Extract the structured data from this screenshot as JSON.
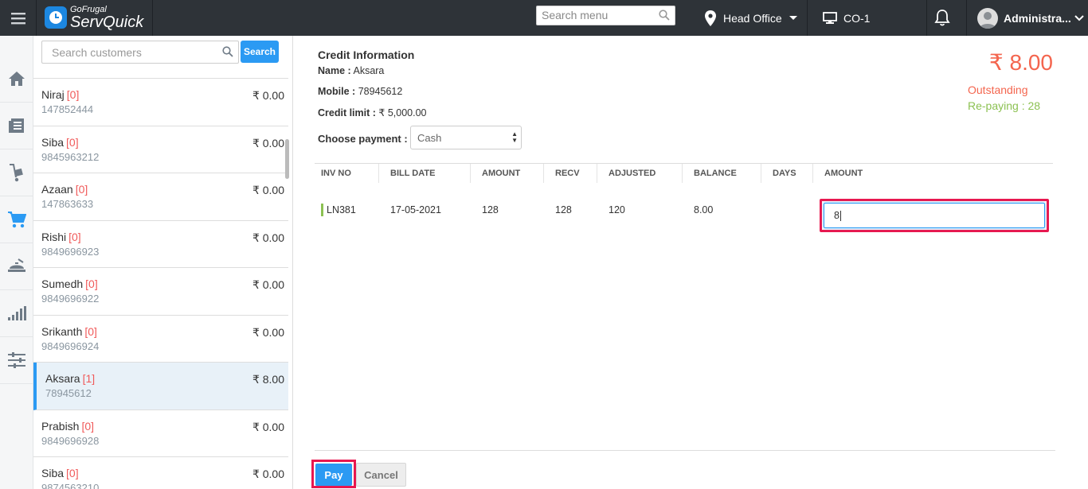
{
  "topbar": {
    "logo_small": "GoFrugal",
    "logo_big": "ServQuick",
    "search_placeholder": "Search menu",
    "location": "Head Office",
    "counter": "CO-1",
    "user": "Administra..."
  },
  "rail": {
    "icons": [
      "home-icon",
      "catalog-icon",
      "delivery-icon",
      "cart-icon",
      "kitchen-icon",
      "reports-icon",
      "settings-icon"
    ]
  },
  "customers": {
    "search_placeholder": "Search customers",
    "search_button": "Search",
    "items": [
      {
        "name": "Niraj",
        "count": "[0]",
        "phone": "147852444",
        "amount": "₹ 0.00"
      },
      {
        "name": "Siba",
        "count": "[0]",
        "phone": "9845963212",
        "amount": "₹ 0.00"
      },
      {
        "name": "Azaan",
        "count": "[0]",
        "phone": "147863633",
        "amount": "₹ 0.00"
      },
      {
        "name": "Rishi",
        "count": "[0]",
        "phone": "9849696923",
        "amount": "₹ 0.00"
      },
      {
        "name": "Sumedh",
        "count": "[0]",
        "phone": "9849696922",
        "amount": "₹ 0.00"
      },
      {
        "name": "Srikanth",
        "count": "[0]",
        "phone": "9849696924",
        "amount": "₹ 0.00"
      },
      {
        "name": "Aksara",
        "count": "[1]",
        "phone": "78945612",
        "amount": "₹ 8.00",
        "active": true
      },
      {
        "name": "Prabish",
        "count": "[0]",
        "phone": "9849696928",
        "amount": "₹ 0.00"
      },
      {
        "name": "Siba",
        "count": "[0]",
        "phone": "9874563210",
        "amount": "₹ 0.00"
      }
    ]
  },
  "credit": {
    "title": "Credit Information",
    "name_label": "Name :",
    "name_value": "Aksara",
    "mobile_label": "Mobile :",
    "mobile_value": "78945612",
    "limit_label": "Credit limit :",
    "limit_value": "₹ 5,000.00",
    "choose_payment_label": "Choose payment :",
    "payment_selected": "Cash",
    "outstanding_amount": "₹ 8.00",
    "outstanding_label": "Outstanding",
    "repaying_label": "Re-paying : 28"
  },
  "table": {
    "headers": [
      "INV NO",
      "BILL DATE",
      "AMOUNT",
      "RECV",
      "ADJUSTED",
      "BALANCE",
      "DAYS",
      "AMOUNT"
    ],
    "rows": [
      {
        "inv_no": "LN381",
        "bill_date": "17-05-2021",
        "amount": "128",
        "recv": "128",
        "adjusted": "120",
        "balance": "8.00",
        "days": "",
        "input_amount": "8"
      }
    ]
  },
  "actions": {
    "pay": "Pay",
    "cancel": "Cancel"
  },
  "colors": {
    "topbar": "#2e3338",
    "accent": "#2b9af3",
    "outstanding": "#f4654e",
    "repaying": "#8cc152",
    "highlight": "#e8174f"
  }
}
